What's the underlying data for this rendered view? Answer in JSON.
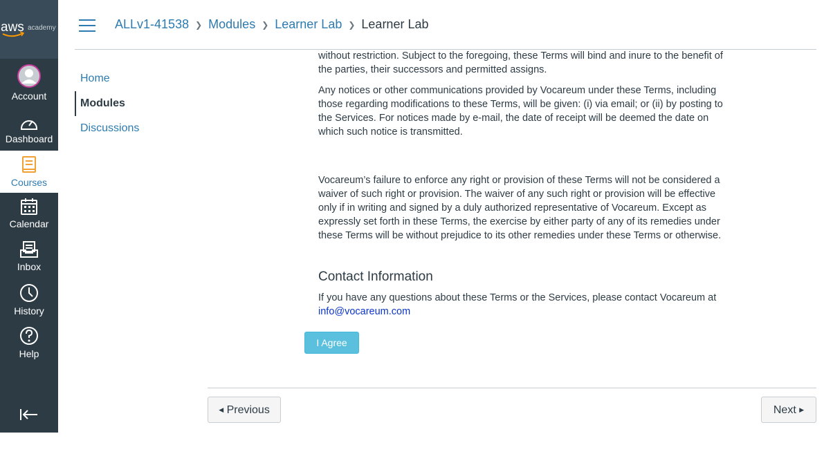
{
  "global_nav": {
    "logo": {
      "brand": "aws",
      "sub": "academy"
    },
    "items": [
      {
        "label": "Account",
        "icon": "account-avatar-icon"
      },
      {
        "label": "Dashboard",
        "icon": "dashboard-icon"
      },
      {
        "label": "Courses",
        "icon": "courses-icon",
        "active": true
      },
      {
        "label": "Calendar",
        "icon": "calendar-icon"
      },
      {
        "label": "Inbox",
        "icon": "inbox-icon"
      },
      {
        "label": "History",
        "icon": "history-icon"
      },
      {
        "label": "Help",
        "icon": "help-icon"
      }
    ],
    "collapse_icon": "collapse-nav-icon"
  },
  "breadcrumbs": [
    "ALLv1-41538",
    "Modules",
    "Learner Lab",
    "Learner Lab"
  ],
  "course_nav": [
    "Home",
    "Modules",
    "Discussions"
  ],
  "content": {
    "para1": "without restriction. Subject to the foregoing, these Terms will bind and inure to the benefit of the parties, their successors and permitted assigns.",
    "para2": "Any notices or other communications provided by Vocareum under these Terms, including those regarding modifications to these Terms, will be given: (i) via email; or (ii) by posting to the Services. For notices made by e-mail, the date of receipt will be deemed the date on which such notice is transmitted.",
    "para3": "Vocareum’s failure to enforce any right or provision of these Terms will not be considered a waiver of such right or provision. The waiver of any such right or provision will be effective only if in writing and signed by a duly authorized representative of Vocareum. Except as expressly set forth in these Terms, the exercise by either party of any of its remedies under these Terms will be without prejudice to its other remedies under these Terms or otherwise.",
    "contact_heading": "Contact Information",
    "contact_text": "If you have any questions about these Terms or the Services, please contact Vocareum at",
    "contact_email": "info@vocareum.com"
  },
  "agree_button": "I Agree",
  "pager": {
    "previous": "Previous",
    "next": "Next"
  },
  "colors": {
    "nav_bg": "#2d3b45",
    "link": "#2d7bb0",
    "agree": "#5bc0de",
    "email_link": "#0b35c9"
  }
}
